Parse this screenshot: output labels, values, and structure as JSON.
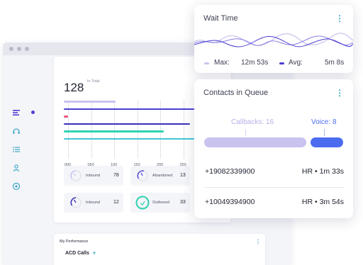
{
  "dashboard": {
    "total_value": "128",
    "total_caption": "In Total",
    "chart_ticks": [
      "000",
      "050",
      "100",
      "150",
      "200",
      "250"
    ],
    "bars": [
      {
        "color": "#c8c3ef",
        "fraction": 0.34
      },
      {
        "color": "#4c3fd1",
        "fraction": 1.0
      },
      {
        "color": "#e7557a",
        "fraction": 0.03
      },
      {
        "color": "#3a2fb8",
        "fraction": 0.83
      },
      {
        "color": "#2fd2b0",
        "fraction": 0.66
      },
      {
        "color": "#3fc6d6",
        "fraction": 1.0
      }
    ],
    "stats": [
      {
        "label": "Inbound",
        "value": "78",
        "icon": "gauge-icon",
        "color": "#c8c3ef"
      },
      {
        "label": "Abandoned",
        "value": "13",
        "icon": "gauge-icon",
        "color": "#4c3fd1"
      },
      {
        "label": "Inbound",
        "value": "12",
        "icon": "gauge-icon",
        "color": "#3a2fb8"
      },
      {
        "label": "Outbound",
        "value": "33",
        "icon": "ring-icon",
        "color": "#2fd2b0"
      }
    ],
    "performance": {
      "title": "My Performance",
      "selected": "ACD Calls"
    }
  },
  "sidebar": {
    "icons": [
      "bar-list-icon",
      "headset-icon",
      "list-icon",
      "user-icon",
      "target-icon"
    ],
    "accent": "#3fa8c6"
  },
  "wait_time": {
    "title": "Wait Time",
    "max_label": "Max:",
    "max_value": "12m 53s",
    "avg_label": "Avg:",
    "avg_value": "5m 8s",
    "max_color": "#c8c3ef",
    "avg_color": "#4c3fd1"
  },
  "contacts_queue": {
    "title": "Contacts in Queue",
    "callbacks_label": "Callbacks: 16",
    "voice_label": "Voice: 8",
    "callbacks": 16,
    "voice": 8,
    "callbacks_color": "#c8c3ef",
    "voice_color": "#4c6cf0",
    "rows": [
      {
        "number": "+19082339900",
        "dept": "HR",
        "time": "1m 33s"
      },
      {
        "number": "+10049394900",
        "dept": "HR",
        "time": "3m 54s"
      }
    ]
  }
}
